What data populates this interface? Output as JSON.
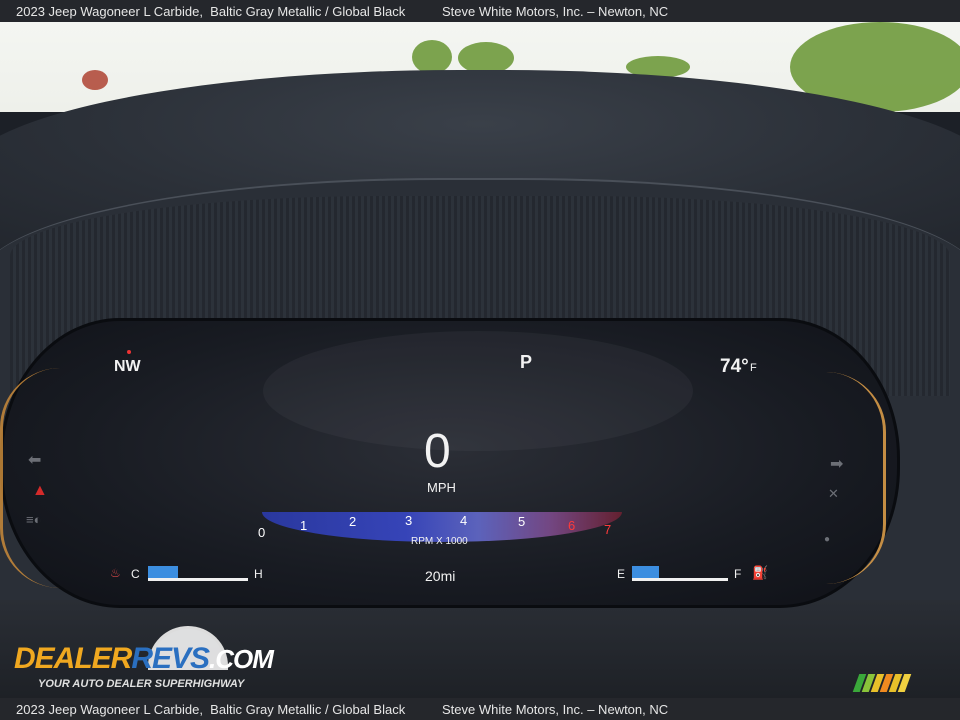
{
  "caption": {
    "vehicle": "2023 Jeep Wagoneer L Carbide,  Baltic Gray Metallic / Global Black",
    "dealer": "Steve White Motors, Inc. – Newton, NC"
  },
  "cluster": {
    "heading": "NW",
    "gear": "P",
    "outside_temp": "74°",
    "outside_temp_unit": "F",
    "speed": "0",
    "speed_unit": "MPH",
    "tach_label": "RPM X 1000",
    "tach_ticks": [
      "0",
      "1",
      "2",
      "3",
      "4",
      "5",
      "6",
      "7"
    ],
    "range": "20mi",
    "coolant_gauge": {
      "low": "C",
      "high": "H",
      "level_fraction": 0.3
    },
    "fuel_gauge": {
      "low": "E",
      "high": "F",
      "level_fraction": 0.28
    }
  },
  "watermark": {
    "logo_part1": "DEALER",
    "logo_part2": "REVS",
    "logo_part3": ".COM",
    "tagline": "YOUR AUTO DEALER SUPERHIGHWAY"
  },
  "colors": {
    "caption_bar": "#26282c",
    "tach_blue": "#3847c4",
    "redline": "#ff3a3a",
    "gauge_fill": "#3c8ee0",
    "accent_amber": "#d79a48"
  }
}
